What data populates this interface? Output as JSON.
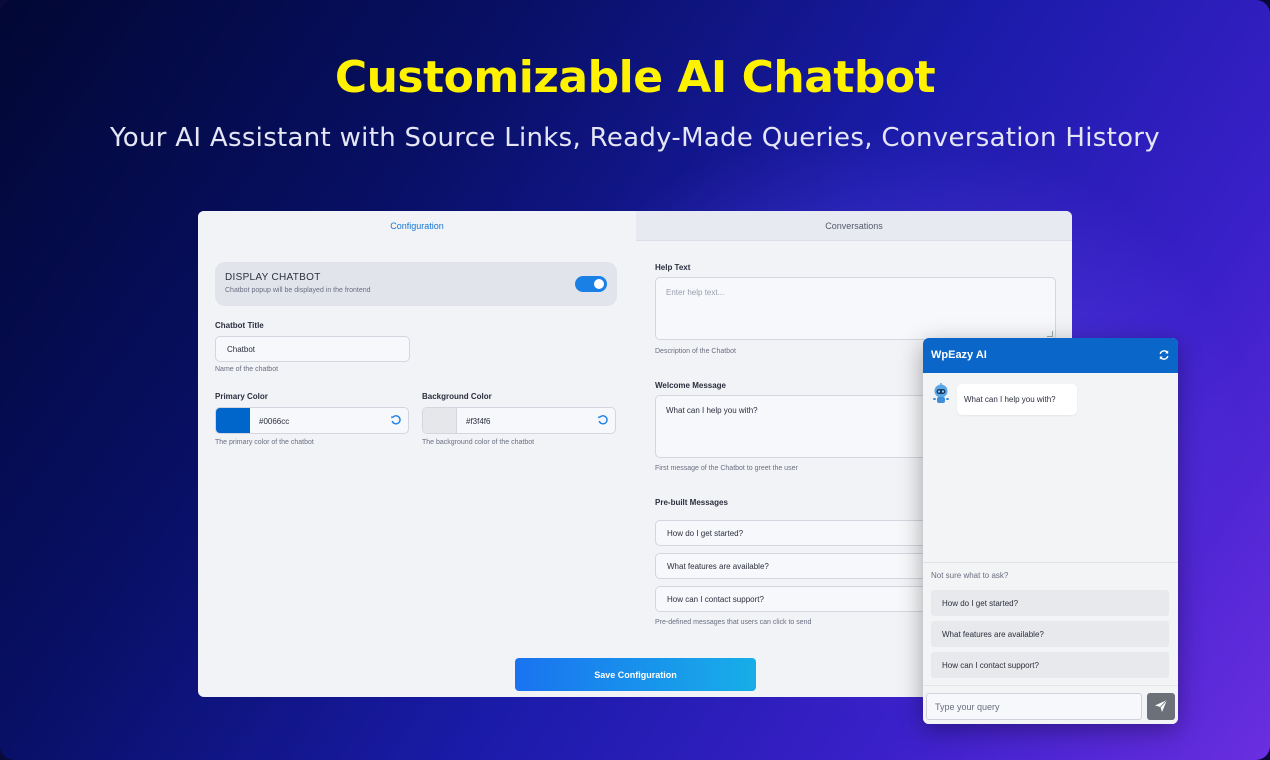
{
  "hero": {
    "title": "Customizable AI Chatbot",
    "subtitle": "Your AI Assistant with Source Links, Ready-Made Queries, Conversation History"
  },
  "tabs": [
    {
      "label": "Configuration",
      "active": true
    },
    {
      "label": "Conversations",
      "active": false
    }
  ],
  "config": {
    "display_chatbot": {
      "title": "DISPLAY CHATBOT",
      "description": "Chatbot popup will be displayed in the frontend",
      "enabled": true
    },
    "chatbot_title": {
      "label": "Chatbot Title",
      "value": "Chatbot",
      "hint": "Name of the chatbot"
    },
    "primary_color": {
      "label": "Primary Color",
      "value": "#0066cc",
      "hint": "The primary color of the chatbot"
    },
    "background_color": {
      "label": "Background Color",
      "value": "#f3f4f6",
      "hint": "The background color of the chatbot"
    },
    "help_text": {
      "label": "Help Text",
      "placeholder": "Enter help text...",
      "hint": "Description of the Chatbot"
    },
    "welcome_message": {
      "label": "Welcome Message",
      "value": "What can I help you with?",
      "hint": "First message of the Chatbot to greet the user"
    },
    "prebuilt_messages": {
      "label": "Pre-built Messages",
      "items": [
        "How do I get started?",
        "What features are available?",
        "How can I contact support?"
      ],
      "hint": "Pre-defined messages that users can click to send"
    },
    "save_label": "Save Configuration"
  },
  "widget": {
    "title": "WpEazy AI",
    "bot_message": "What can I help you with?",
    "suggest_label": "Not sure what to ask?",
    "suggestions": [
      "How do I get started?",
      "What features are available?",
      "How can I contact support?"
    ],
    "input_placeholder": "Type your query",
    "icons": {
      "refresh": "refresh-icon",
      "send": "send-icon",
      "avatar": "robot-avatar-icon"
    }
  },
  "colors": {
    "accent": "#1a80e6",
    "title_yellow": "#fff200",
    "widget_header": "#0a66c8"
  }
}
